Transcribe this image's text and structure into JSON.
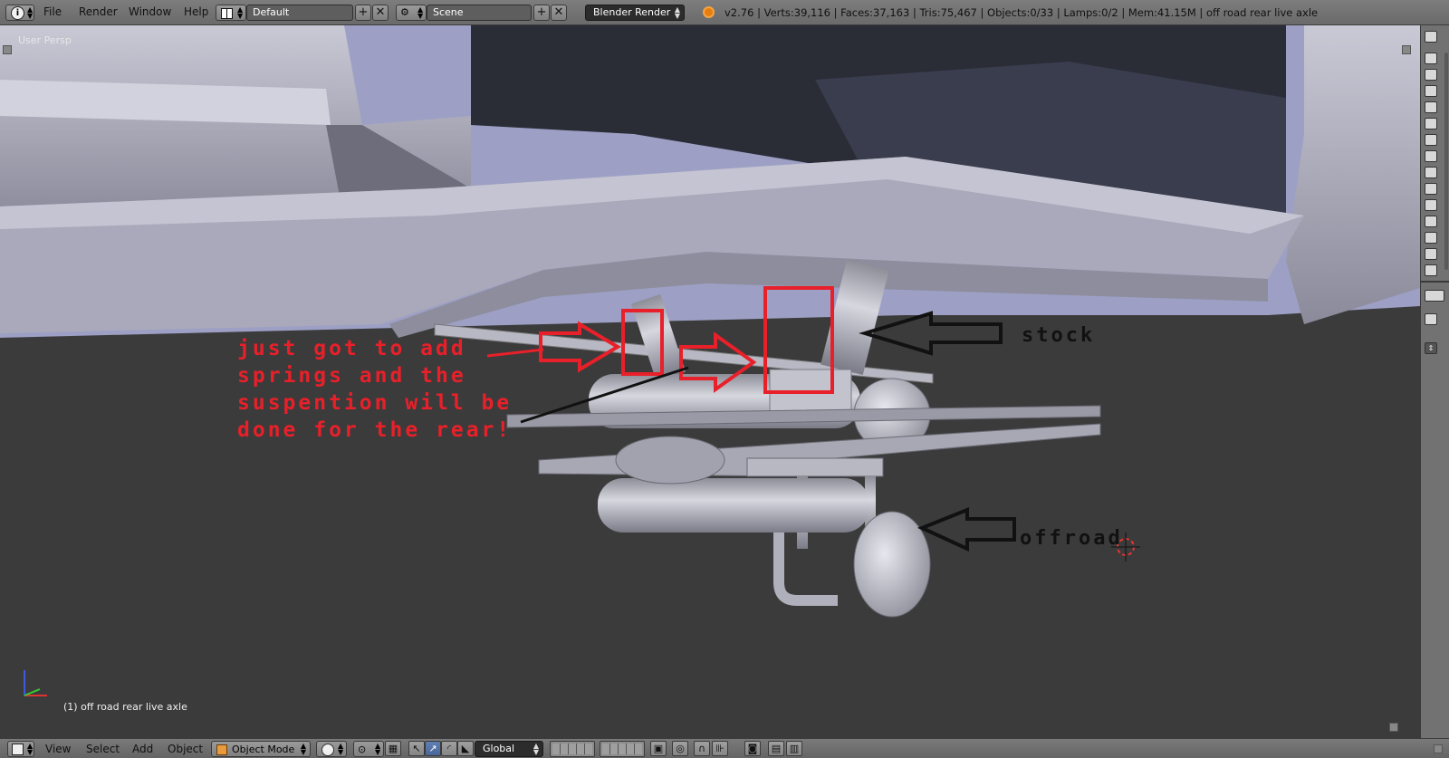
{
  "top_bar": {
    "menus": [
      "File",
      "Render",
      "Window",
      "Help"
    ],
    "screen_layout": "Default",
    "scene": "Scene",
    "render_engine": "Blender Render",
    "stats": "v2.76 | Verts:39,116 | Faces:37,163 | Tris:75,467 | Objects:0/33 | Lamps:0/2 | Mem:41.15M | off road rear live axle"
  },
  "viewport": {
    "view_label": "User Persp",
    "object_label": "(1) off road rear live axle",
    "annotations": {
      "red_note": "just got to add\nsprings and the\nsuspention will be\ndone for the rear!",
      "stock": "stock",
      "offroad": "offroad"
    },
    "colors": {
      "annotation_red": "#e8202a",
      "annotation_black": "#111111",
      "ground": "#3b3b3b",
      "mesh": "#b5b5c4"
    }
  },
  "bottom_bar": {
    "menus": [
      "View",
      "Select",
      "Add",
      "Object"
    ],
    "mode": "Object Mode",
    "transform_orientation": "Global"
  },
  "icons": [
    "info-icon",
    "screen-layout-icon",
    "scene-icon",
    "blender-logo-icon",
    "viewport-shading-icon",
    "pivot-icon",
    "manipulator-icon",
    "layers-icon",
    "render-icon"
  ]
}
